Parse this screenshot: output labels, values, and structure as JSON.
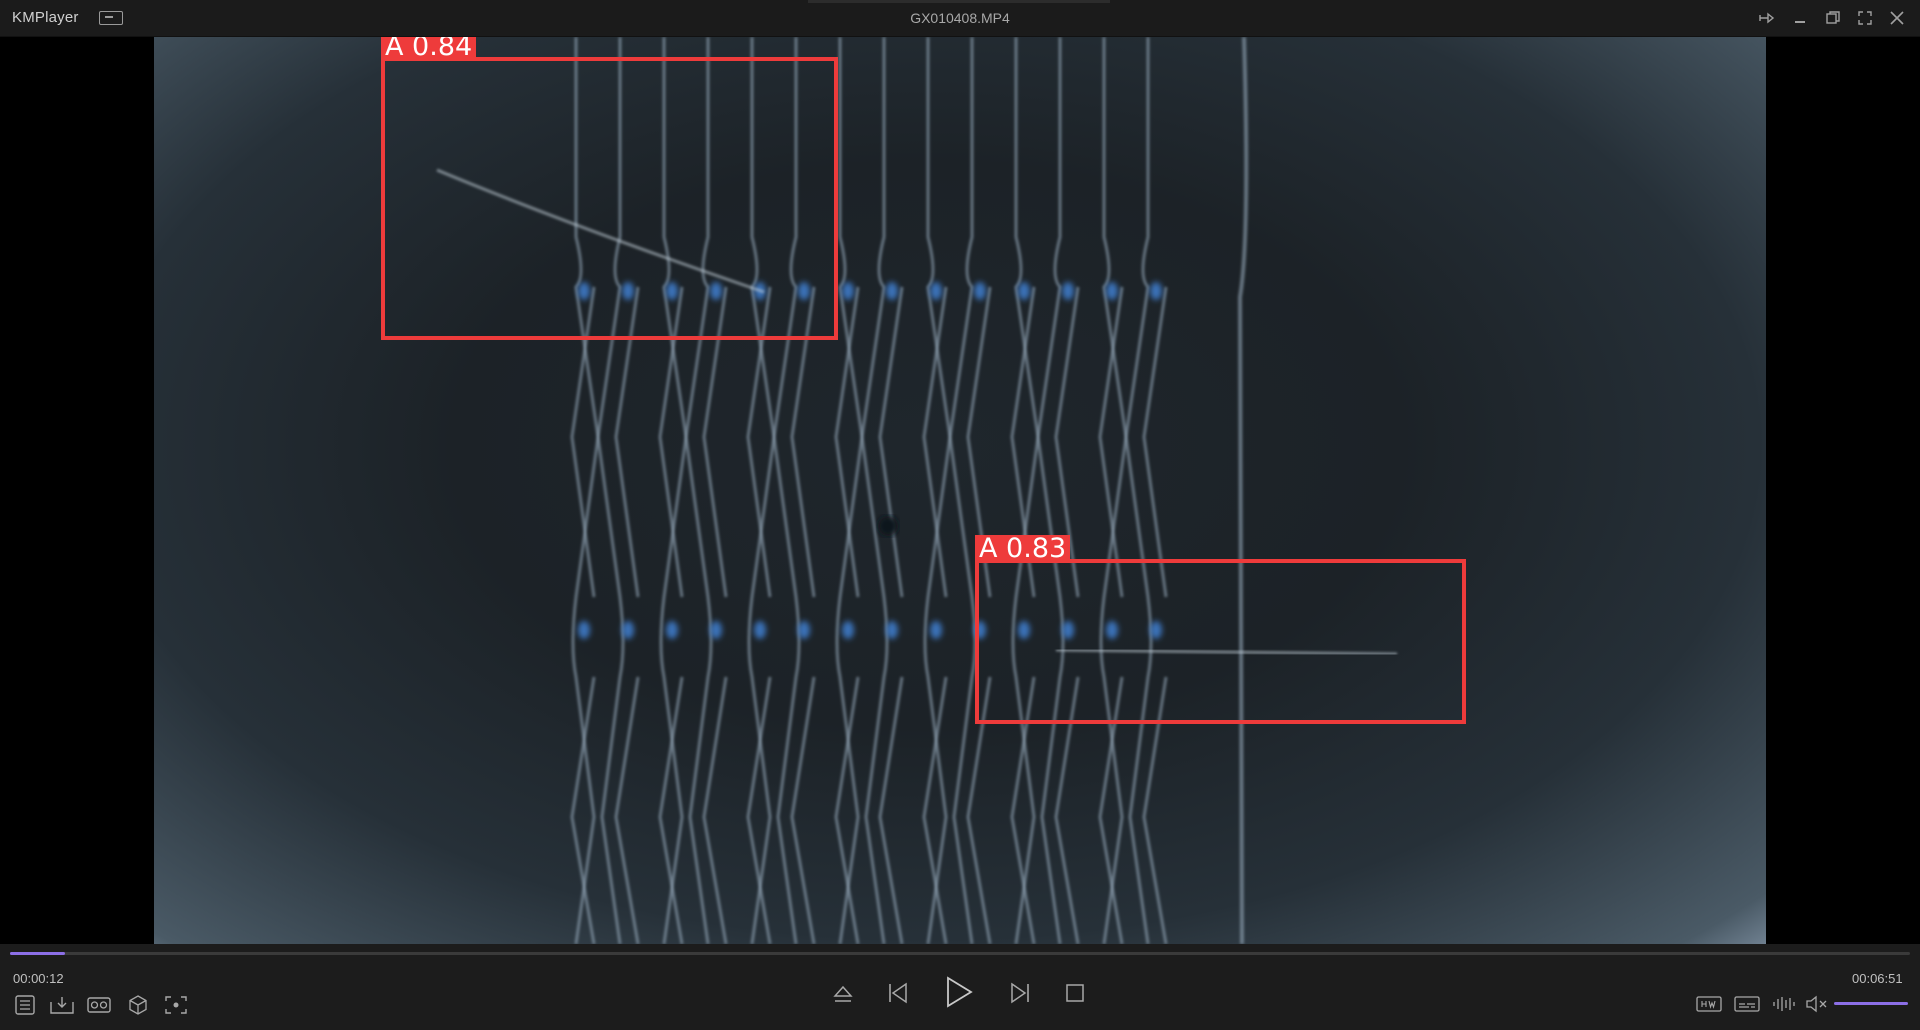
{
  "app": {
    "name": "KMPlayer",
    "file_title": "GX010408.MP4"
  },
  "detections": [
    {
      "label": "A 0.84",
      "class": "A",
      "confidence": 0.84
    },
    {
      "label": "A 0.83",
      "class": "A",
      "confidence": 0.83
    }
  ],
  "playback": {
    "current_time": "00:00:12",
    "total_time": "00:06:51",
    "progress": 0.029,
    "volume": 1.0,
    "accent_color": "#8c6fe6"
  },
  "icons": {
    "window": [
      "mini-mode-icon",
      "pin-icon",
      "minimize-icon",
      "restore-icon",
      "fullscreen-icon",
      "close-icon"
    ],
    "left_tools": [
      "playlist-icon",
      "download-icon",
      "vr-icon",
      "3d-icon",
      "capture-icon"
    ],
    "transport": [
      "eject-icon",
      "previous-icon",
      "play-icon",
      "next-icon",
      "stop-icon"
    ],
    "right_tools": [
      "hw-decoder-icon",
      "subtitle-icon",
      "equalizer-icon",
      "mute-icon"
    ]
  },
  "colors": {
    "bbox": "#ee3b3b",
    "titlebar": "#1b1b1b",
    "controlbar": "#1c1c1c"
  }
}
